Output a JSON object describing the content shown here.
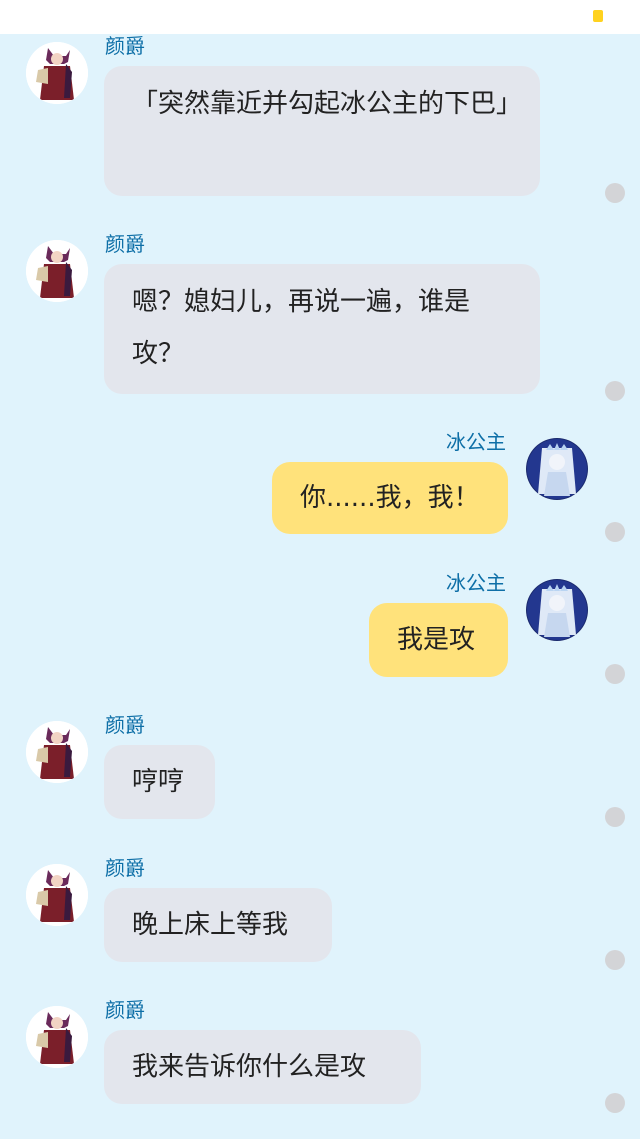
{
  "chat": {
    "messages": [
      {
        "side": "left",
        "sender": "颜爵",
        "text": "「突然靠近并勾起冰公主的下巴」"
      },
      {
        "side": "left",
        "sender": "颜爵",
        "text": "嗯？媳妇儿，再说一遍，谁是攻？"
      },
      {
        "side": "right",
        "sender": "冰公主",
        "text": "你......我，我！"
      },
      {
        "side": "right",
        "sender": "冰公主",
        "text": "我是攻"
      },
      {
        "side": "left",
        "sender": "颜爵",
        "text": "哼哼"
      },
      {
        "side": "left",
        "sender": "颜爵",
        "text": "晚上床上等我"
      },
      {
        "side": "left",
        "sender": "颜爵",
        "text": "我来告诉你什么是攻"
      }
    ]
  },
  "colors": {
    "background": "#e0f3fc",
    "left_bubble": "#e3e6ed",
    "right_bubble": "#ffe27b",
    "name_text": "#0e6fa7",
    "status_dot": "#d3d4d7"
  },
  "icons": {
    "left_avatar": "character-avatar-red-robe",
    "right_avatar": "character-avatar-ice-princess",
    "status": "message-status-dot"
  }
}
